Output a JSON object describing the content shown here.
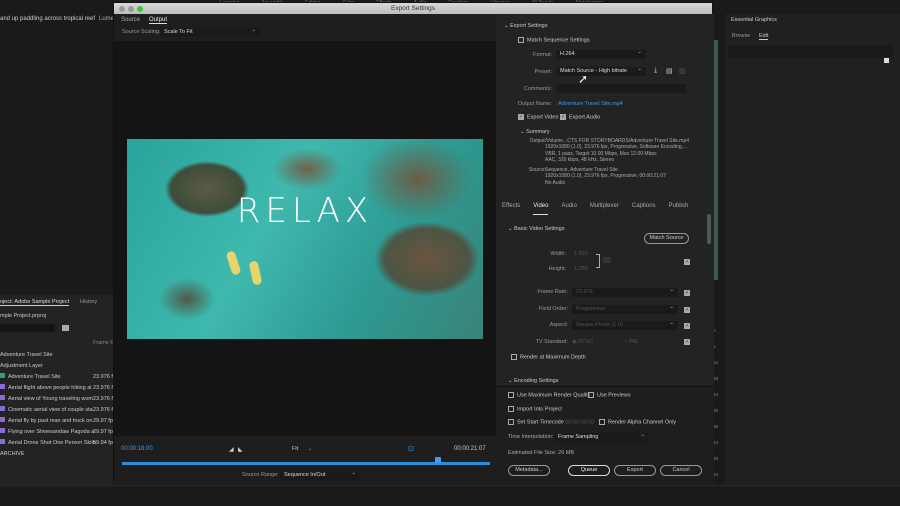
{
  "workspace_menu": [
    "Learning",
    "Assembly",
    "Editing",
    "Color",
    "Effects",
    "Audio",
    "Graphics",
    "Libraries",
    "All Panels",
    "Metalogging"
  ],
  "background": {
    "sequence_title": "and up paddling across tropical reef",
    "lumetri_tab": "Lumeti",
    "project_panel": {
      "title": "oject: Adobe Sample Project",
      "history_tab": "History",
      "file": "mple Project.prproj",
      "column": "Frame Ra",
      "items": [
        {
          "name": "Adventure Travel Site",
          "rate": ""
        },
        {
          "name": "Adjustment Layer",
          "rate": ""
        },
        {
          "name": "Adventure Travel Site",
          "rate": "23.976 fp"
        },
        {
          "name": "Aerial flight above people hiking al",
          "rate": "23.976 fp"
        },
        {
          "name": "Aerial view of Young traveling wom",
          "rate": "23.976 fp"
        },
        {
          "name": "Cinematic aerial view of couple sta",
          "rate": "23.976 fp"
        },
        {
          "name": "Aerial fly by past man and truck on",
          "rate": "29.97 fps"
        },
        {
          "name": "Flying over Shwesandaw Pagoda a",
          "rate": "29.97 fps"
        },
        {
          "name": "Aerial Drone Shot One Person Skiin",
          "rate": "59.94 fps"
        },
        {
          "name": "ARCHIVE",
          "rate": ""
        }
      ]
    },
    "essential_graphics": {
      "title": "Essential Graphics",
      "tabs": [
        "Browse",
        "Edit"
      ]
    },
    "ruler": [
      "0",
      "6",
      "12",
      "18",
      "24",
      "30",
      "36",
      "42",
      "48",
      "54"
    ]
  },
  "dialog": {
    "title": "Export Settings",
    "tabs": [
      "Source",
      "Output"
    ],
    "source_scaling_label": "Source Scaling:",
    "source_scaling": "Scale To Fit",
    "preview_text": "RELAX",
    "timecode_in": "00:00:18:00",
    "timecode_out": "00:00:21:07",
    "fit": "Fit",
    "playhead_fraction": 0.86,
    "source_range_label": "Source Range:",
    "source_range": "Sequence In/Out",
    "export_settings": {
      "heading": "Export Settings",
      "match_sequence": "Match Sequence Settings",
      "format_label": "Format:",
      "format": "H.264",
      "preset_label": "Preset:",
      "preset": "Match Source - High bitrate",
      "comments_label": "Comments:",
      "output_name_label": "Output Name:",
      "output_name": "Adventure Travel Site.mp4",
      "export_video": "Export Video",
      "export_audio": "Export Audio",
      "summary_heading": "Summary",
      "output_label": "Output:",
      "output_lines": [
        "/Volume...CTS FOR STORYBOARDS/Adventure Travel Site.mp4",
        "1920x1080 (1.0), 23.976 fps, Progressive, Software Encoding,...",
        "VBR, 1 pass, Target 10.00 Mbps, Max 12.00 Mbps",
        "AAC, 320 kbps, 48 kHz, Stereo"
      ],
      "source_label": "Source:",
      "source_lines": [
        "Sequence, Adventure Travel Site",
        "1920x1080 (1.0), 23.976 fps, Progressive, 00:00:21:07",
        "No Audio"
      ]
    },
    "settings_tabs": [
      "Effects",
      "Video",
      "Audio",
      "Multiplexer",
      "Captions",
      "Publish"
    ],
    "video": {
      "heading": "Basic Video Settings",
      "match_source": "Match Source",
      "width_label": "Width:",
      "width": "1,920",
      "height_label": "Height:",
      "height": "1,080",
      "frame_rate_label": "Frame Rate:",
      "frame_rate": "23.976",
      "field_order_label": "Field Order:",
      "field_order": "Progressive",
      "aspect_label": "Aspect:",
      "aspect": "Square Pixels (1.0)",
      "tv_label": "TV Standard:",
      "ntsc": "NTSC",
      "pal": "PAL",
      "max_depth": "Render at Maximum Depth",
      "encoding_heading": "Encoding Settings"
    },
    "bottom": {
      "max_quality": "Use Maximum Render Quality",
      "use_previews": "Use Previews",
      "import_project": "Import Into Project",
      "start_timecode": "Set Start Timecode",
      "start_tc_value": "00:00:00:00",
      "alpha_only": "Render Alpha Channel Only",
      "time_interp_label": "Time Interpolation:",
      "time_interp": "Frame Sampling",
      "file_size_label": "Estimated File Size:",
      "file_size": "26 MB",
      "metadata": "Metadata...",
      "queue": "Queue",
      "export": "Export",
      "cancel": "Cancel"
    }
  }
}
